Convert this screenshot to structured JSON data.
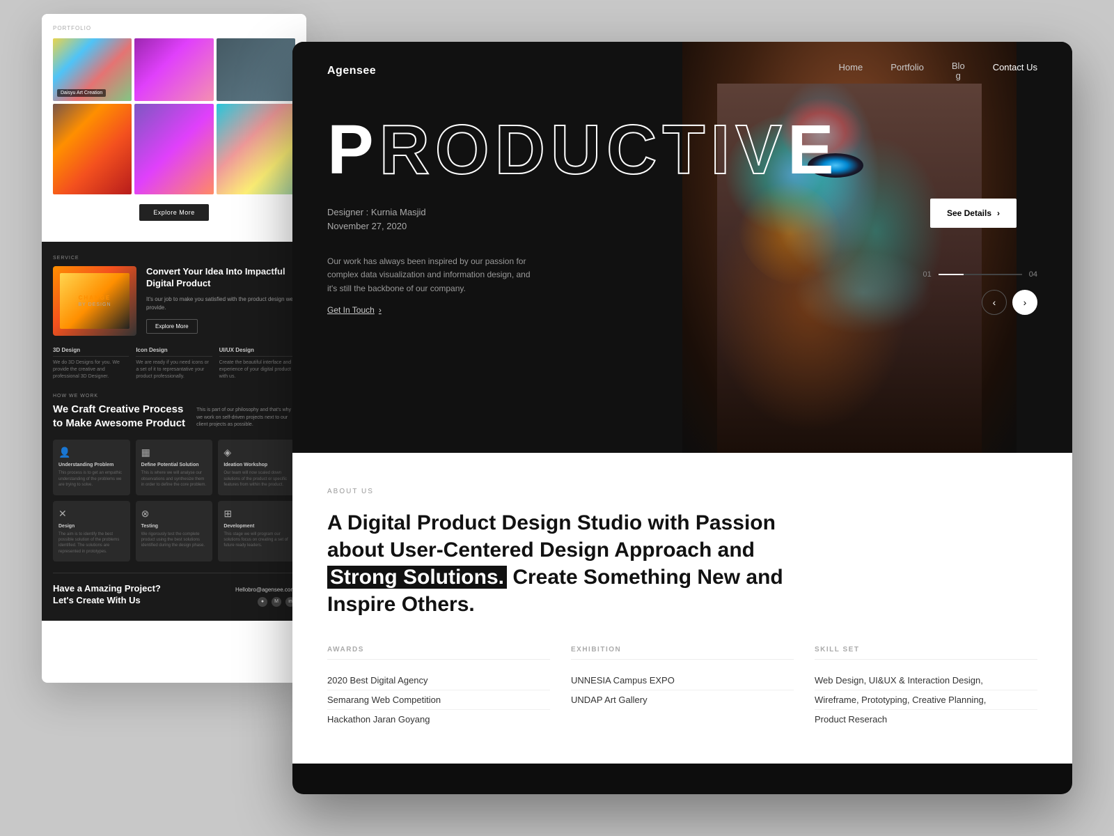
{
  "page": {
    "background_color": "#c8c8c8"
  },
  "left_panel": {
    "portfolio_label": "PORTFOLIO",
    "portfolio_items": [
      {
        "id": 1,
        "label": "Daisyu Art Creation",
        "class": "pi-1"
      },
      {
        "id": 2,
        "label": "",
        "class": "pi-2"
      },
      {
        "id": 3,
        "label": "",
        "class": "pi-3"
      },
      {
        "id": 4,
        "label": "",
        "class": "pi-4"
      },
      {
        "id": 5,
        "label": "",
        "class": "pi-5"
      },
      {
        "id": 6,
        "label": "",
        "class": "pi-6"
      }
    ],
    "explore_more_btn": "Explore More",
    "service_tag": "SERVICE",
    "service_title": "Convert Your Idea Into Impactful Digital Product",
    "service_desc": "It's our job to make you satisfied with the product design we provide.",
    "service_btn": "Explore More",
    "service_image_text": "CHANGE BY DESIGN",
    "services": [
      {
        "title": "3D Design",
        "desc": "We do 3D Designs for you. We provide the creative and professional 3D Designer."
      },
      {
        "title": "Icon Design",
        "desc": "We are ready if you need icons or a set of it to represantative your product professionally."
      },
      {
        "title": "UI/UX Design",
        "desc": "Create the beautiful interface and experience of your digital product with us."
      }
    ],
    "how_we_work_label": "HOW WE WORK",
    "how_title": "We Craft Creative Process to Make Awesome Product",
    "how_desc": "This is part of our philosophy and that's why we work on self-driven projects next to our client projects as possible.",
    "process_items": [
      {
        "icon": "👤",
        "title": "Understanding Problem",
        "desc": "This process is to get an empathic understanding of the problems we are trying to solve."
      },
      {
        "icon": "📊",
        "title": "Define Potential Solution",
        "desc": "This is where we will analyse our observations and synthesize them in order to define the core problem."
      },
      {
        "icon": "💡",
        "title": "Ideation Workshop",
        "desc": "Our team will now scaled down solutions of the product or specific features from within the product."
      },
      {
        "icon": "✏️",
        "title": "Design",
        "desc": "The aim is to identify the best possible solution of the problems identified. The solutions are represented in prototypes."
      },
      {
        "icon": "🔬",
        "title": "Testing",
        "desc": "We rigorously test the complete product using the best solutions identified during the design phase."
      },
      {
        "icon": "💻",
        "title": "Development",
        "desc": "This stage we will program our solutions focus on creating a set of future ready leaders."
      }
    ],
    "footer_cta_title": "Have a Amazing Project? Let's Create With Us",
    "footer_email": "Hellobro@agensee.com",
    "footer_icons": [
      "●",
      "M",
      "in"
    ]
  },
  "right_panel": {
    "nav": {
      "logo": "Agensee",
      "links": [
        {
          "label": "Home"
        },
        {
          "label": "Portfolio"
        },
        {
          "label": "Blog"
        },
        {
          "label": "Contact Us"
        }
      ]
    },
    "hero": {
      "title_part1": "P",
      "title_hollow": "RODUCTIV",
      "title_part2": "E",
      "designer_label": "Designer : Kurnia Masjid",
      "date": "November 27, 2020",
      "see_details_btn": "See Details",
      "description": "Our work has always been inspired by our passion for complex data visualization and information design, and it's still the backbone of our company.",
      "get_in_touch": "Get In Touch",
      "slider_current": "01",
      "slider_total": "04"
    },
    "about": {
      "label": "ABOUT US",
      "title_part1": "A Digital Product Design Studio with Passion about User-Centered Design Approach and ",
      "title_highlight": "Strong Solutions.",
      "title_part2": " Create Something New and Inspire Others.",
      "stats": {
        "awards": {
          "label": "AWARDS",
          "items": [
            "2020 Best Digital Agency",
            "Semarang Web Competition",
            "Hackathon Jaran Goyang"
          ]
        },
        "exhibition": {
          "label": "EXHIBITION",
          "items": [
            "UNNESIA Campus EXPO",
            "UNDAP Art Gallery"
          ]
        },
        "skill_set": {
          "label": "SKILL SET",
          "items": [
            "Web Design, UI&UX & Interaction Design,",
            "Wireframe, Prototyping, Creative Planning,",
            "Product Reserach"
          ]
        }
      }
    }
  }
}
